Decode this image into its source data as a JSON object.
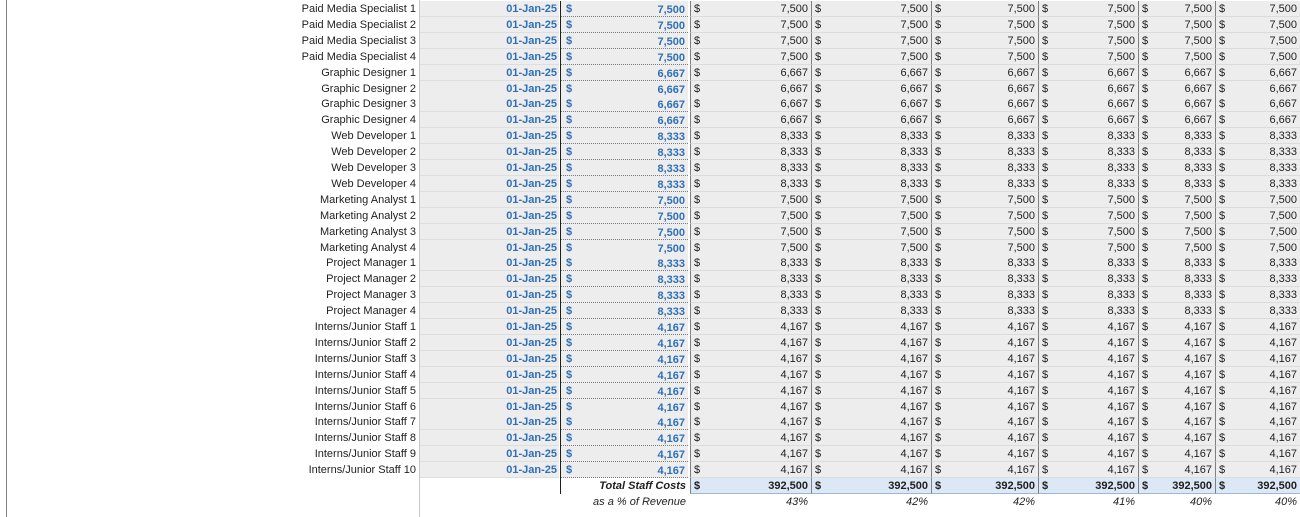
{
  "sheet": {
    "currency_symbol": "$",
    "rows": [
      {
        "label": "Paid Media Specialist 1",
        "start": "01-Jan-25",
        "salary": "7,500",
        "monthly": [
          "7,500",
          "7,500",
          "7,500",
          "7,500",
          "7,500",
          "7,500"
        ]
      },
      {
        "label": "Paid Media Specialist 2",
        "start": "01-Jan-25",
        "salary": "7,500",
        "monthly": [
          "7,500",
          "7,500",
          "7,500",
          "7,500",
          "7,500",
          "7,500"
        ]
      },
      {
        "label": "Paid Media Specialist 3",
        "start": "01-Jan-25",
        "salary": "7,500",
        "monthly": [
          "7,500",
          "7,500",
          "7,500",
          "7,500",
          "7,500",
          "7,500"
        ]
      },
      {
        "label": "Paid Media Specialist 4",
        "start": "01-Jan-25",
        "salary": "7,500",
        "monthly": [
          "7,500",
          "7,500",
          "7,500",
          "7,500",
          "7,500",
          "7,500"
        ]
      },
      {
        "label": "Graphic Designer 1",
        "start": "01-Jan-25",
        "salary": "6,667",
        "monthly": [
          "6,667",
          "6,667",
          "6,667",
          "6,667",
          "6,667",
          "6,667"
        ]
      },
      {
        "label": "Graphic Designer 2",
        "start": "01-Jan-25",
        "salary": "6,667",
        "monthly": [
          "6,667",
          "6,667",
          "6,667",
          "6,667",
          "6,667",
          "6,667"
        ]
      },
      {
        "label": "Graphic Designer 3",
        "start": "01-Jan-25",
        "salary": "6,667",
        "monthly": [
          "6,667",
          "6,667",
          "6,667",
          "6,667",
          "6,667",
          "6,667"
        ]
      },
      {
        "label": "Graphic Designer 4",
        "start": "01-Jan-25",
        "salary": "6,667",
        "monthly": [
          "6,667",
          "6,667",
          "6,667",
          "6,667",
          "6,667",
          "6,667"
        ]
      },
      {
        "label": "Web Developer 1",
        "start": "01-Jan-25",
        "salary": "8,333",
        "monthly": [
          "8,333",
          "8,333",
          "8,333",
          "8,333",
          "8,333",
          "8,333"
        ]
      },
      {
        "label": "Web Developer 2",
        "start": "01-Jan-25",
        "salary": "8,333",
        "monthly": [
          "8,333",
          "8,333",
          "8,333",
          "8,333",
          "8,333",
          "8,333"
        ]
      },
      {
        "label": "Web Developer 3",
        "start": "01-Jan-25",
        "salary": "8,333",
        "monthly": [
          "8,333",
          "8,333",
          "8,333",
          "8,333",
          "8,333",
          "8,333"
        ]
      },
      {
        "label": "Web Developer 4",
        "start": "01-Jan-25",
        "salary": "8,333",
        "monthly": [
          "8,333",
          "8,333",
          "8,333",
          "8,333",
          "8,333",
          "8,333"
        ]
      },
      {
        "label": "Marketing Analyst 1",
        "start": "01-Jan-25",
        "salary": "7,500",
        "monthly": [
          "7,500",
          "7,500",
          "7,500",
          "7,500",
          "7,500",
          "7,500"
        ]
      },
      {
        "label": "Marketing Analyst 2",
        "start": "01-Jan-25",
        "salary": "7,500",
        "monthly": [
          "7,500",
          "7,500",
          "7,500",
          "7,500",
          "7,500",
          "7,500"
        ]
      },
      {
        "label": "Marketing Analyst 3",
        "start": "01-Jan-25",
        "salary": "7,500",
        "monthly": [
          "7,500",
          "7,500",
          "7,500",
          "7,500",
          "7,500",
          "7,500"
        ]
      },
      {
        "label": "Marketing Analyst 4",
        "start": "01-Jan-25",
        "salary": "7,500",
        "monthly": [
          "7,500",
          "7,500",
          "7,500",
          "7,500",
          "7,500",
          "7,500"
        ]
      },
      {
        "label": "Project Manager 1",
        "start": "01-Jan-25",
        "salary": "8,333",
        "monthly": [
          "8,333",
          "8,333",
          "8,333",
          "8,333",
          "8,333",
          "8,333"
        ]
      },
      {
        "label": "Project Manager 2",
        "start": "01-Jan-25",
        "salary": "8,333",
        "monthly": [
          "8,333",
          "8,333",
          "8,333",
          "8,333",
          "8,333",
          "8,333"
        ]
      },
      {
        "label": "Project Manager 3",
        "start": "01-Jan-25",
        "salary": "8,333",
        "monthly": [
          "8,333",
          "8,333",
          "8,333",
          "8,333",
          "8,333",
          "8,333"
        ]
      },
      {
        "label": "Project Manager 4",
        "start": "01-Jan-25",
        "salary": "8,333",
        "monthly": [
          "8,333",
          "8,333",
          "8,333",
          "8,333",
          "8,333",
          "8,333"
        ]
      },
      {
        "label": "Interns/Junior Staff 1",
        "start": "01-Jan-25",
        "salary": "4,167",
        "monthly": [
          "4,167",
          "4,167",
          "4,167",
          "4,167",
          "4,167",
          "4,167"
        ]
      },
      {
        "label": "Interns/Junior Staff 2",
        "start": "01-Jan-25",
        "salary": "4,167",
        "monthly": [
          "4,167",
          "4,167",
          "4,167",
          "4,167",
          "4,167",
          "4,167"
        ]
      },
      {
        "label": "Interns/Junior Staff 3",
        "start": "01-Jan-25",
        "salary": "4,167",
        "monthly": [
          "4,167",
          "4,167",
          "4,167",
          "4,167",
          "4,167",
          "4,167"
        ]
      },
      {
        "label": "Interns/Junior Staff 4",
        "start": "01-Jan-25",
        "salary": "4,167",
        "monthly": [
          "4,167",
          "4,167",
          "4,167",
          "4,167",
          "4,167",
          "4,167"
        ]
      },
      {
        "label": "Interns/Junior Staff 5",
        "start": "01-Jan-25",
        "salary": "4,167",
        "monthly": [
          "4,167",
          "4,167",
          "4,167",
          "4,167",
          "4,167",
          "4,167"
        ]
      },
      {
        "label": "Interns/Junior Staff 6",
        "start": "01-Jan-25",
        "salary": "4,167",
        "monthly": [
          "4,167",
          "4,167",
          "4,167",
          "4,167",
          "4,167",
          "4,167"
        ]
      },
      {
        "label": "Interns/Junior Staff 7",
        "start": "01-Jan-25",
        "salary": "4,167",
        "monthly": [
          "4,167",
          "4,167",
          "4,167",
          "4,167",
          "4,167",
          "4,167"
        ]
      },
      {
        "label": "Interns/Junior Staff 8",
        "start": "01-Jan-25",
        "salary": "4,167",
        "monthly": [
          "4,167",
          "4,167",
          "4,167",
          "4,167",
          "4,167",
          "4,167"
        ]
      },
      {
        "label": "Interns/Junior Staff 9",
        "start": "01-Jan-25",
        "salary": "4,167",
        "monthly": [
          "4,167",
          "4,167",
          "4,167",
          "4,167",
          "4,167",
          "4,167"
        ]
      },
      {
        "label": "Interns/Junior Staff 10",
        "start": "01-Jan-25",
        "salary": "4,167",
        "monthly": [
          "4,167",
          "4,167",
          "4,167",
          "4,167",
          "4,167",
          "4,167"
        ]
      }
    ],
    "total": {
      "label": "Total Staff Costs",
      "values": [
        "392,500",
        "392,500",
        "392,500",
        "392,500",
        "392,500",
        "392,500"
      ]
    },
    "pct": {
      "label": "as a % of Revenue",
      "values": [
        "43%",
        "42%",
        "42%",
        "41%",
        "40%",
        "40%"
      ]
    },
    "colors": {
      "input_blue": "#2f6fb5",
      "input_fill": "#ededed",
      "total_fill": "#dce8f5"
    }
  }
}
